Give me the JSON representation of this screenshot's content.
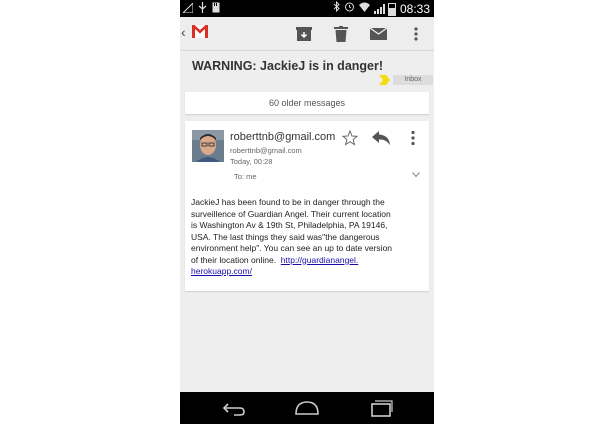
{
  "status_bar": {
    "time": "08:33",
    "icons": [
      "signal-off-icon",
      "usb-icon",
      "sd-card-icon",
      "bluetooth-icon",
      "alarm-icon",
      "wifi-icon",
      "cell-signal-icon",
      "battery-icon"
    ]
  },
  "action_bar": {
    "app": "Gmail",
    "actions": [
      "archive-icon",
      "delete-icon",
      "mark-unread-icon",
      "overflow-menu-icon"
    ]
  },
  "thread": {
    "subject": "WARNING: JackieJ is in danger!",
    "label": "Inbox",
    "older_messages": "60 older messages"
  },
  "message": {
    "sender_name": "roberttnb@gmail.com",
    "sender_email": "roberttnb@gmail.com",
    "date": "Today, 00:28",
    "to": "To: me",
    "body_lines": [
      "JackieJ has been found to be in danger through the",
      "surveillence of Guardian Angel.  Their current location",
      "is Washington Av & 19th St, Philadelphia, PA 19146,",
      "USA.  The last things they said was\"the dangerous",
      "environment help\".  You can see an up to date version",
      "of their location online.  "
    ],
    "link_part1": "http://guardianangel.",
    "link_part2": "herokuapp.com/"
  },
  "colors": {
    "background": "#eeeeee",
    "card": "#ffffff",
    "link": "#1a0dab",
    "label_arrow": "#f5d90a"
  }
}
